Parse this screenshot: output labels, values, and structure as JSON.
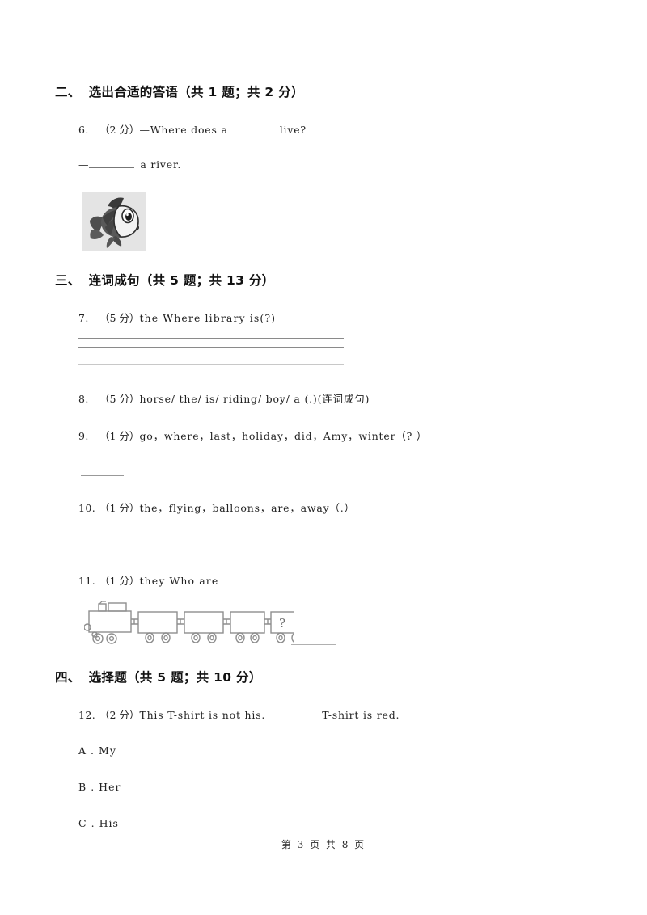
{
  "document": {
    "page_footer": "第 3 页 共 8 页"
  },
  "sections": [
    {
      "number": "二、",
      "title": "选出合适的答语（共 1 题；共 2 分）"
    },
    {
      "number": "三、",
      "title": "连词成句（共 5 题；共 13 分）"
    },
    {
      "number": "四、",
      "title": "选择题（共 5 题；共 10 分）"
    }
  ],
  "questions": {
    "q6": {
      "number": "6.",
      "score": "（2 分）",
      "text_before": "—Where does a",
      "text_after": "live?",
      "answer_line_prefix": "—",
      "answer_line_after": "a river.",
      "image": "fish-illustration"
    },
    "q7": {
      "number": "7.",
      "score": "（5 分）",
      "text": "the     Where     library     is(?)"
    },
    "q8": {
      "number": "8.",
      "score": "（5 分）",
      "text": "horse/ the/ is/ riding/ boy/ a (.)(连词成句)"
    },
    "q9": {
      "number": "9.",
      "score": "（1 分）",
      "text": "go，where，last，holiday，did，Amy，winter（? ）"
    },
    "q10": {
      "number": "10.",
      "score": "（1 分）",
      "text": "the，flying，balloons，are，away（.）"
    },
    "q11": {
      "number": "11.",
      "score": "（1 分）",
      "text": "they    Who    are",
      "image": "train-illustration",
      "train_car_label": "?"
    },
    "q12": {
      "number": "12.",
      "score": "（2 分）",
      "text_before": "This T-shirt is not his.",
      "text_after": "T-shirt is red.",
      "options": [
        {
          "letter": "A",
          "dot": ".",
          "label": "My"
        },
        {
          "letter": "B",
          "dot": ".",
          "label": "Her"
        },
        {
          "letter": "C",
          "dot": ".",
          "label": "His"
        }
      ]
    }
  },
  "colors": {
    "page_background": "#ffffff",
    "text": "#222222",
    "rule_line": "#8a8a8a",
    "blank_line": "#999999",
    "image_background": "#e4e4e4",
    "train_stroke": "#909090"
  }
}
